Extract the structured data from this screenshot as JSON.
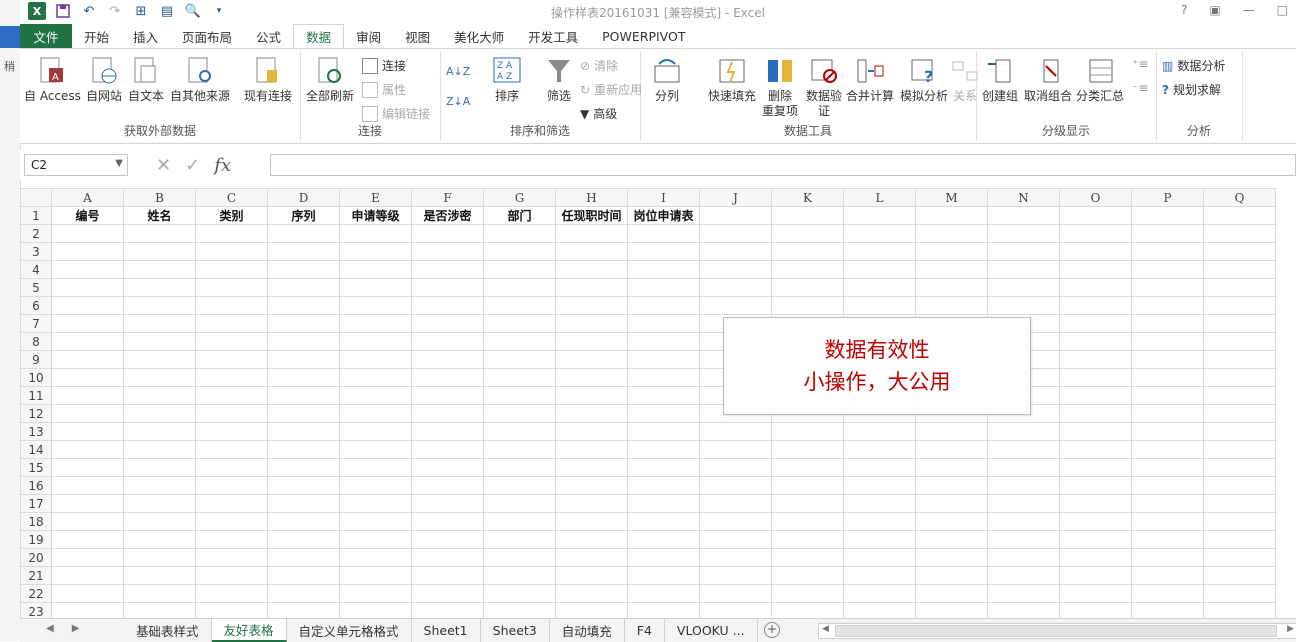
{
  "window": {
    "title": "操作样表20161031  [兼容模式] - Excel",
    "help": "?",
    "restore_icon": "ribbon-display-icon",
    "minimize": "—",
    "maximize": "□"
  },
  "left_strip_char": "稍",
  "ribbon_tabs": [
    "文件",
    "开始",
    "插入",
    "页面布局",
    "公式",
    "数据",
    "审阅",
    "视图",
    "美化大师",
    "开发工具",
    "POWERPIVOT"
  ],
  "active_tab": "数据",
  "groups": {
    "external": {
      "label": "获取外部数据",
      "buttons": [
        "自 Access",
        "自网站",
        "自文本",
        "自其他来源",
        "现有连接"
      ]
    },
    "connections": {
      "label": "连接",
      "refresh": "全部刷新",
      "small": [
        "连接",
        "属性",
        "编辑链接"
      ]
    },
    "sort": {
      "label": "排序和筛选",
      "sort": "排序",
      "filter": "筛选",
      "small": [
        "清除",
        "重新应用",
        "高级"
      ]
    },
    "datatools": {
      "label": "数据工具",
      "buttons": [
        "分列",
        "快速填充",
        "删除\n重复项",
        "数据验\n证",
        "合并计算",
        "模拟分析",
        "关系"
      ]
    },
    "outline": {
      "label": "分级显示",
      "buttons": [
        "创建组",
        "取消组合",
        "分类汇总"
      ]
    },
    "analysis": {
      "label": "分析",
      "small": [
        "数据分析",
        "规划求解"
      ]
    }
  },
  "formula_bar": {
    "name_box": "C2",
    "fx": "fx",
    "value": ""
  },
  "columns": [
    "A",
    "B",
    "C",
    "D",
    "E",
    "F",
    "G",
    "H",
    "I",
    "J",
    "K",
    "L",
    "M",
    "N",
    "O",
    "P",
    "Q"
  ],
  "row_count": 23,
  "header_row": [
    "编号",
    "姓名",
    "类别",
    "序列",
    "申请等级",
    "是否涉密",
    "部门",
    "任现职时间",
    "岗位申请表"
  ],
  "callout": {
    "line1": "数据有效性",
    "line2": "小操作，大公用"
  },
  "sheet_tabs": [
    "基础表样式",
    "友好表格",
    "自定义单元格格式",
    "Sheet1",
    "Sheet3",
    "自动填充",
    "F4",
    "VLOOKU ..."
  ],
  "active_sheet": "友好表格",
  "colors": {
    "excel_green": "#217346",
    "callout_red": "#c00000"
  }
}
